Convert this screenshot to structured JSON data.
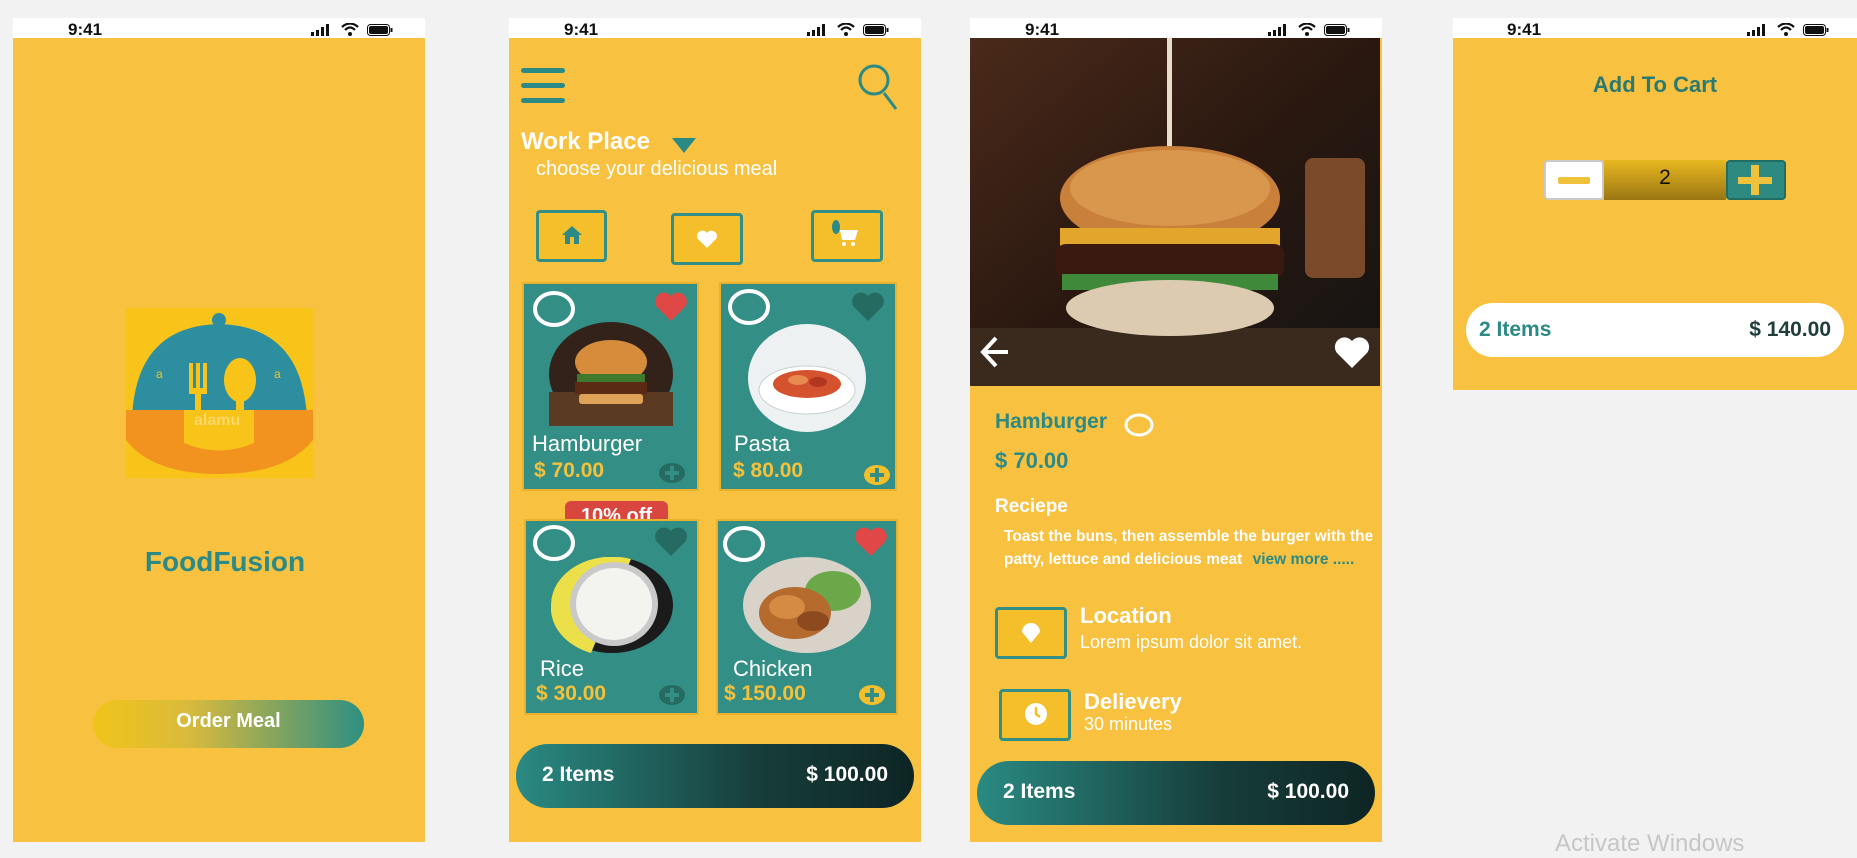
{
  "status": {
    "time": "9:41"
  },
  "splash": {
    "brand": "FoodFusion",
    "logo_text": "alamu",
    "order_button": "Order Meal"
  },
  "menu": {
    "location": "Work Place",
    "subtitle": "choose your delicious meal",
    "discount_badge": "10% off",
    "items": [
      {
        "name": "Hamburger",
        "price": "$ 70.00"
      },
      {
        "name": "Pasta",
        "price": "$ 80.00"
      },
      {
        "name": "Rice",
        "price": "$ 30.00"
      },
      {
        "name": "Chicken",
        "price": "$ 150.00"
      }
    ],
    "cart_items": "2 Items",
    "cart_total": "$ 100.00"
  },
  "detail": {
    "name": "Hamburger",
    "price": "$ 70.00",
    "recipe_heading": "Reciepe",
    "recipe_line1": "Toast the buns, then assemble the burger with the",
    "recipe_line2": "patty, lettuce and delicious meat",
    "view_more": "view more .....",
    "location_title": "Location",
    "location_text": "Lorem ipsum dolor sit amet.",
    "delivery_title": "Delievery",
    "delivery_text": "30 minutes",
    "cart_items": "2 Items",
    "cart_total": "$ 100.00"
  },
  "cart": {
    "title": "Add To Cart",
    "quantity": "2",
    "items": "2 Items",
    "total": "$ 140.00"
  },
  "watermark": "Activate Windows",
  "colors": {
    "background": "#f8c13f",
    "teal": "#2b8a86",
    "heart_red": "#e04848",
    "badge_red": "#d9453f"
  }
}
